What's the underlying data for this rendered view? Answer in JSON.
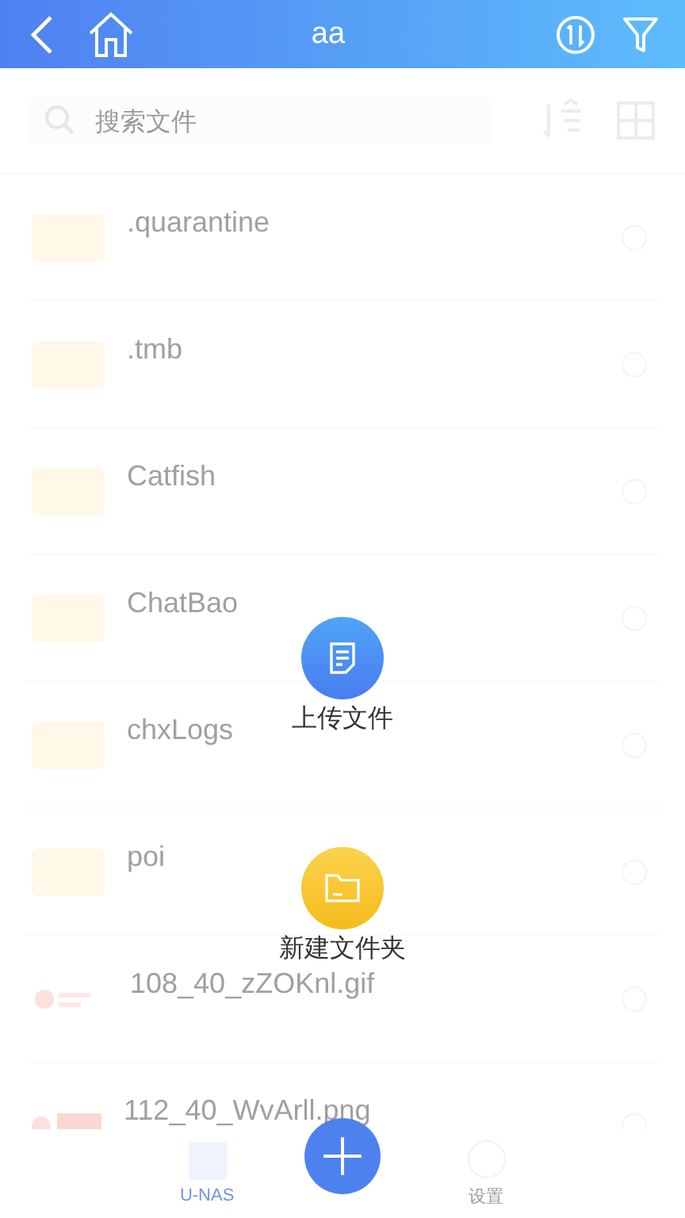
{
  "header": {
    "title": "aa"
  },
  "search": {
    "placeholder": "搜索文件"
  },
  "files": [
    {
      "kind": "folder",
      "name": ".quarantine"
    },
    {
      "kind": "folder",
      "name": ".tmb"
    },
    {
      "kind": "folder",
      "name": "Catfish"
    },
    {
      "kind": "folder",
      "name": "ChatBao"
    },
    {
      "kind": "folder",
      "name": "chxLogs"
    },
    {
      "kind": "folder",
      "name": "poi"
    },
    {
      "kind": "gif",
      "name": "108_40_zZOKnl.gif"
    },
    {
      "kind": "png",
      "name": "112_40_WvArll.png"
    }
  ],
  "actions": [
    {
      "kind": "upload",
      "label": "上传文件"
    },
    {
      "kind": "new-folder",
      "label": "新建文件夹"
    }
  ],
  "bottom_nav": [
    {
      "label": "U-NAS",
      "selected": true
    },
    {
      "label": "设置",
      "selected": false
    }
  ]
}
